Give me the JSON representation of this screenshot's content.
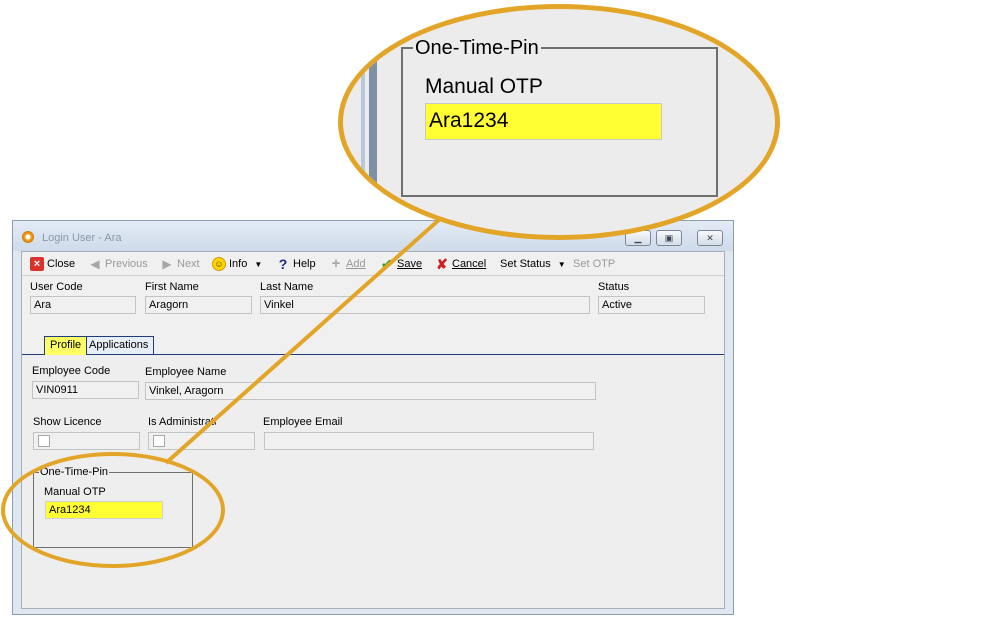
{
  "window": {
    "title": "Login User - Ara",
    "controls": [
      "minimize",
      "restore",
      "close"
    ]
  },
  "toolbar": {
    "close": "Close",
    "previous": "Previous",
    "next": "Next",
    "info": "Info",
    "help": "Help",
    "add": "Add",
    "save": "Save",
    "cancel": "Cancel",
    "set_status": "Set Status",
    "set_otp": "Set OTP"
  },
  "header": {
    "user_code_label": "User Code",
    "user_code": "Ara",
    "first_name_label": "First Name",
    "first_name": "Aragorn",
    "last_name_label": "Last Name",
    "last_name": "Vinkel",
    "status_label": "Status",
    "status": "Active"
  },
  "tabs": [
    {
      "label": "Profile",
      "active": true
    },
    {
      "label": "Applications",
      "active": false
    }
  ],
  "profile": {
    "employee_code_label": "Employee Code",
    "employee_code": "VIN0911",
    "employee_name_label": "Employee Name",
    "employee_name": "Vinkel, Aragorn",
    "show_licence_label": "Show Licence",
    "is_administrator_label": "Is Administrator",
    "employee_email_label": "Employee Email",
    "employee_email": ""
  },
  "otp": {
    "group_title": "One-Time-Pin",
    "manual_otp_label": "Manual OTP",
    "manual_otp_value": "Ara1234"
  },
  "colors": {
    "highlight_ring": "#e3a527",
    "field_highlight": "#ffff33",
    "active_tab": "#ffff66"
  }
}
